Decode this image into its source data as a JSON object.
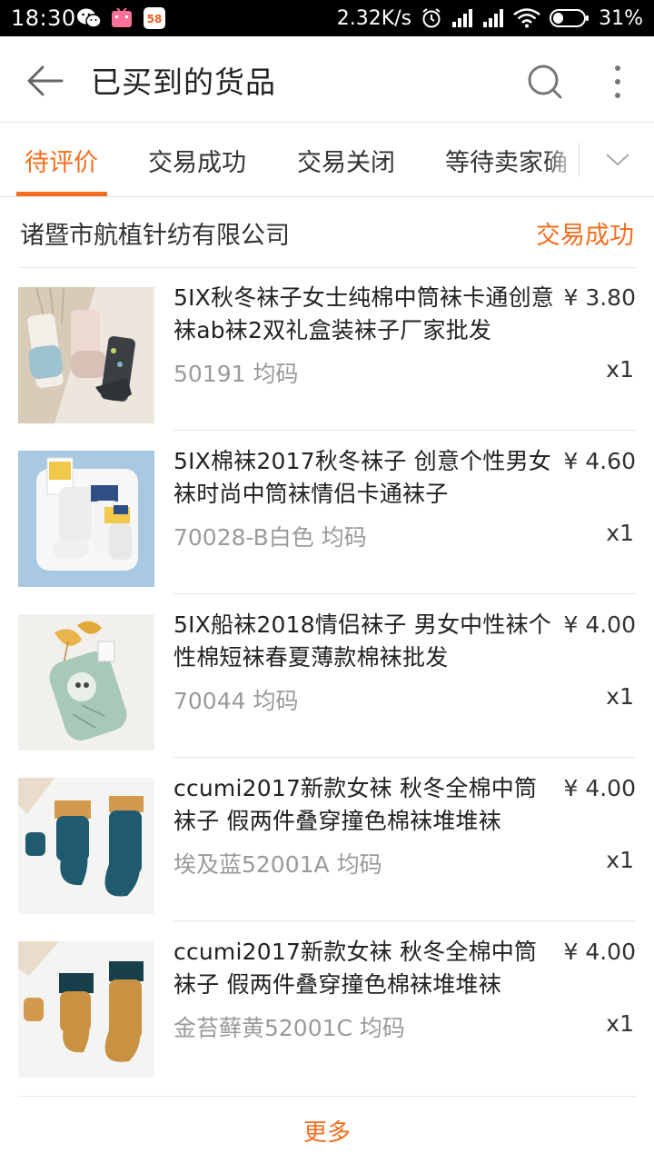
{
  "status_bar": {
    "time": "18:30",
    "net_speed": "2.32K/s",
    "battery": "31%",
    "icons": [
      "wechat-icon",
      "bilibili-icon",
      "58-app-icon",
      "alarm-icon",
      "signal-icon",
      "signal-icon",
      "wifi-icon",
      "battery-icon"
    ]
  },
  "appbar": {
    "title": "已买到的货品",
    "icons": [
      "back-arrow-icon",
      "search-icon",
      "more-vertical-icon"
    ]
  },
  "tabs": {
    "items": [
      {
        "label": "待评价",
        "active": true
      },
      {
        "label": "交易成功",
        "active": false
      },
      {
        "label": "交易关闭",
        "active": false
      },
      {
        "label": "等待卖家确",
        "active": false
      }
    ],
    "accent": "#f56e1e"
  },
  "order": {
    "shop_name": "诸暨市航植针纺有限公司",
    "status": "交易成功",
    "items": [
      {
        "title": "5IX秋冬袜子女士纯棉中筒袜卡通创意袜ab袜2双礼盒装袜子厂家批发",
        "price": "¥ 3.80",
        "spec": "50191 均码",
        "qty": "x1"
      },
      {
        "title": "5IX棉袜2017秋冬袜子 创意个性男女袜时尚中筒袜情侣卡通袜子",
        "price": "¥ 4.60",
        "spec": "70028-B白色 均码",
        "qty": "x1"
      },
      {
        "title": "5IX船袜2018情侣袜子 男女中性袜个性棉短袜春夏薄款棉袜批发",
        "price": "¥ 4.00",
        "spec": "70044 均码",
        "qty": "x1"
      },
      {
        "title": "ccumi2017新款女袜 秋冬全棉中筒袜子 假两件叠穿撞色棉袜堆堆袜",
        "price": "¥ 4.00",
        "spec": "埃及蓝52001A 均码",
        "qty": "x1"
      },
      {
        "title": "ccumi2017新款女袜 秋冬全棉中筒袜子 假两件叠穿撞色棉袜堆堆袜",
        "price": "¥ 4.00",
        "spec": "金苔藓黄52001C 均码",
        "qty": "x1"
      }
    ]
  },
  "footer": {
    "more_label": "更多"
  }
}
